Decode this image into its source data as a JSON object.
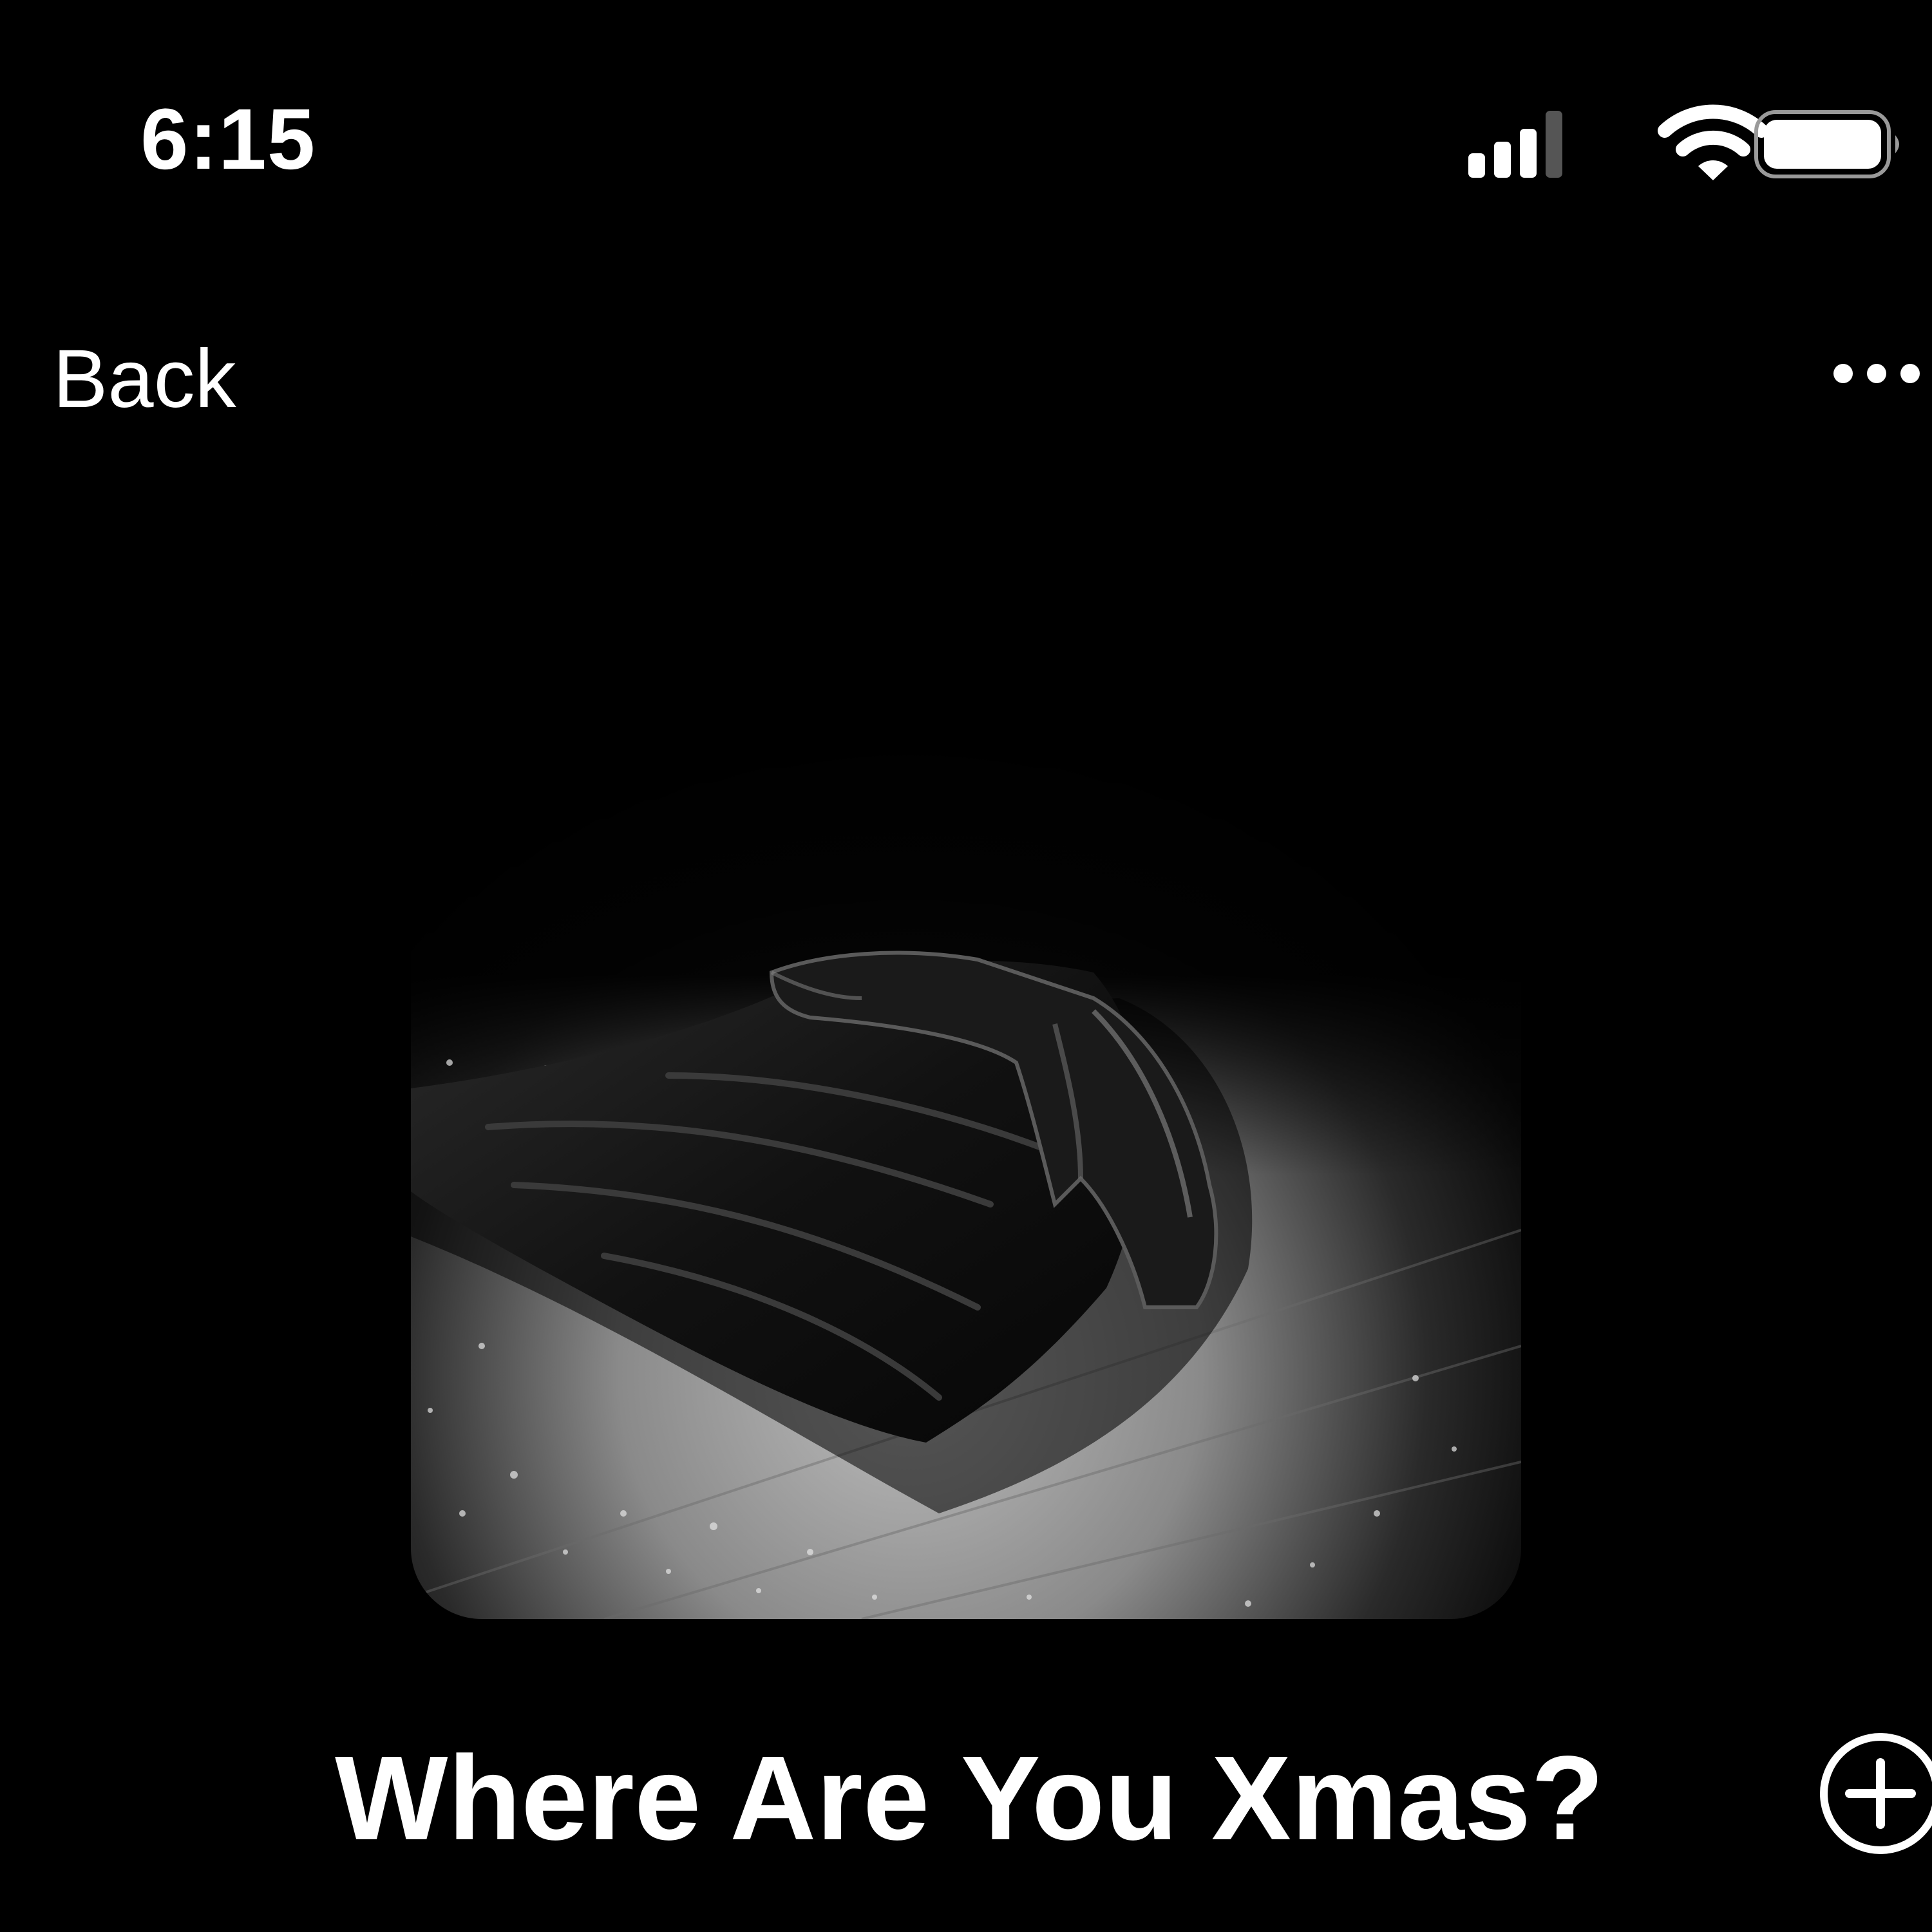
{
  "status_bar": {
    "time": "6:15",
    "icons": [
      "cellular-signal-icon",
      "wifi-icon",
      "battery-icon"
    ]
  },
  "nav": {
    "back_label": "Back",
    "more_icon": "ellipsis-icon"
  },
  "artwork": {
    "description_icon": "album-artwork"
  },
  "track": {
    "title": "Where Are You Xmas?",
    "add_icon": "plus-circle-icon"
  },
  "colors": {
    "background": "#000000",
    "foreground": "#ffffff"
  }
}
